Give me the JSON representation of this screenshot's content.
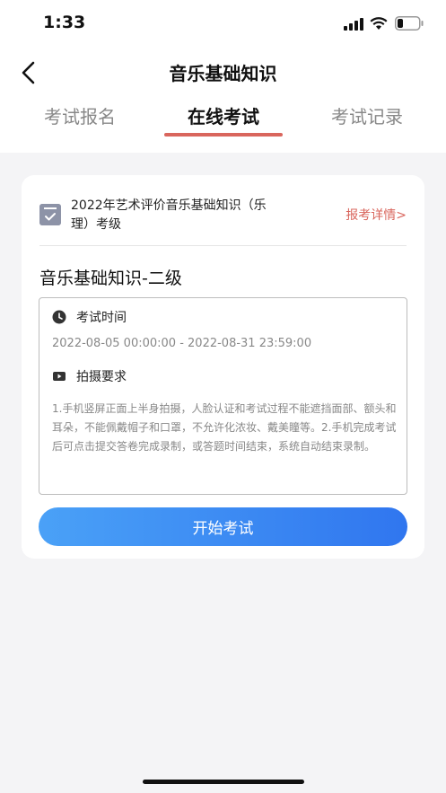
{
  "status_bar": {
    "time": "1:33"
  },
  "nav": {
    "title": "音乐基础知识"
  },
  "tabs": [
    {
      "label": "考试报名"
    },
    {
      "label": "在线考试"
    },
    {
      "label": "考试记录"
    }
  ],
  "exam": {
    "name": "2022年艺术评价音乐基础知识（乐理）考级",
    "detail_link": "报考详情>",
    "level_title": "音乐基础知识-二级",
    "time_label": "考试时间",
    "time_range": "2022-08-05 00:00:00 - 2022-08-31 23:59:00",
    "photo_label": "拍摄要求",
    "requirements": "1.手机竖屏正面上半身拍摄，人脸认证和考试过程不能遮挡面部、额头和耳朵，不能佩戴帽子和口罩，不允许化浓妆、戴美瞳等。2.手机完成考试后可点击提交答卷完成录制，或答题时间结束，系统自动结束录制。",
    "start_button": "开始考试"
  },
  "colors": {
    "accent_red": "#d9665d",
    "button_blue": "#3b8df3"
  }
}
